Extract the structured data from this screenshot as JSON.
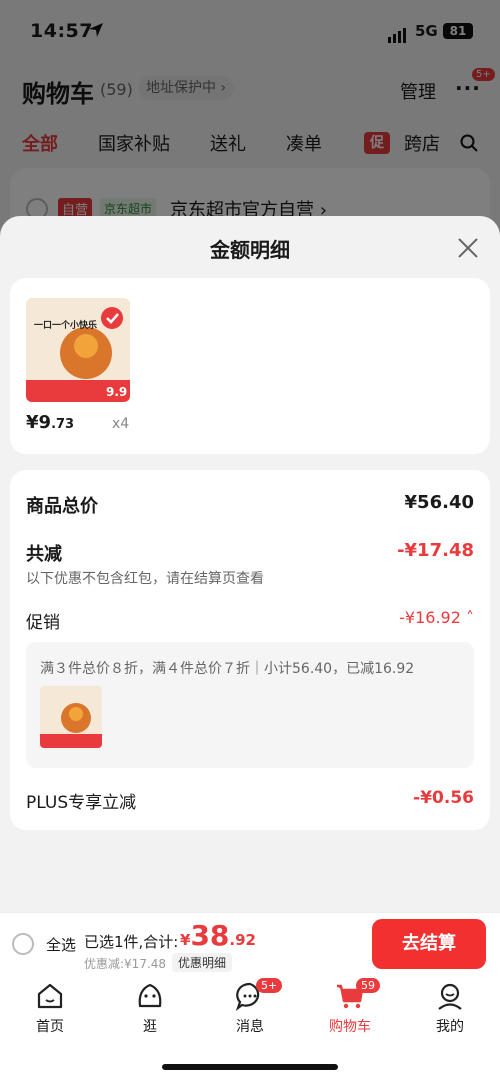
{
  "status": {
    "time": "14:57",
    "network": "5G",
    "battery": "81"
  },
  "cart": {
    "title": "购物车",
    "count": "(59)",
    "address_protect": "地址保护中 ›",
    "manage": "管理",
    "more_badge": "5+",
    "filters": [
      "全部",
      "国家补贴",
      "送礼",
      "凑单",
      "跨店"
    ],
    "promo_tag": "促",
    "store": {
      "self_tag": "自营",
      "jd_tag": "京东超市",
      "name": "京东超市官方自营 ›"
    }
  },
  "sheet": {
    "title": "金额明细",
    "item": {
      "price_int": "¥9",
      "price_dec": ".73",
      "qty": "x4"
    },
    "product_thumb_text": "一口一个小快乐",
    "product_price_tag": "9.9",
    "rows": {
      "total_label": "商品总价",
      "total_value": "¥56.40",
      "reduce_label": "共减",
      "reduce_value": "-¥17.48",
      "reduce_note": "以下优惠不包含红包，请在结算页查看",
      "promo_label": "促销",
      "promo_value": "-¥16.92 ˄",
      "promo_desc": "满３件总价８折，满４件总价７折｜小计56.40，已减16.92",
      "plus_label": "PLUS专享立减",
      "plus_value": "-¥0.56"
    }
  },
  "checkout": {
    "select_all": "全选",
    "selected": "已选1件,合计:",
    "currency": "¥",
    "total_int": "38",
    "total_dec": ".92",
    "discount": "优惠减:¥17.48",
    "detail_pill": "优惠明细",
    "button": "去结算"
  },
  "tabs": [
    {
      "label": "首页",
      "icon": "home-icon"
    },
    {
      "label": "逛",
      "icon": "explore-icon"
    },
    {
      "label": "消息",
      "icon": "message-icon",
      "badge": "5+"
    },
    {
      "label": "购物车",
      "icon": "cart-icon",
      "badge": "59",
      "active": true
    },
    {
      "label": "我的",
      "icon": "profile-icon"
    }
  ],
  "colors": {
    "accent": "#e93b3d",
    "button": "#f23030"
  }
}
